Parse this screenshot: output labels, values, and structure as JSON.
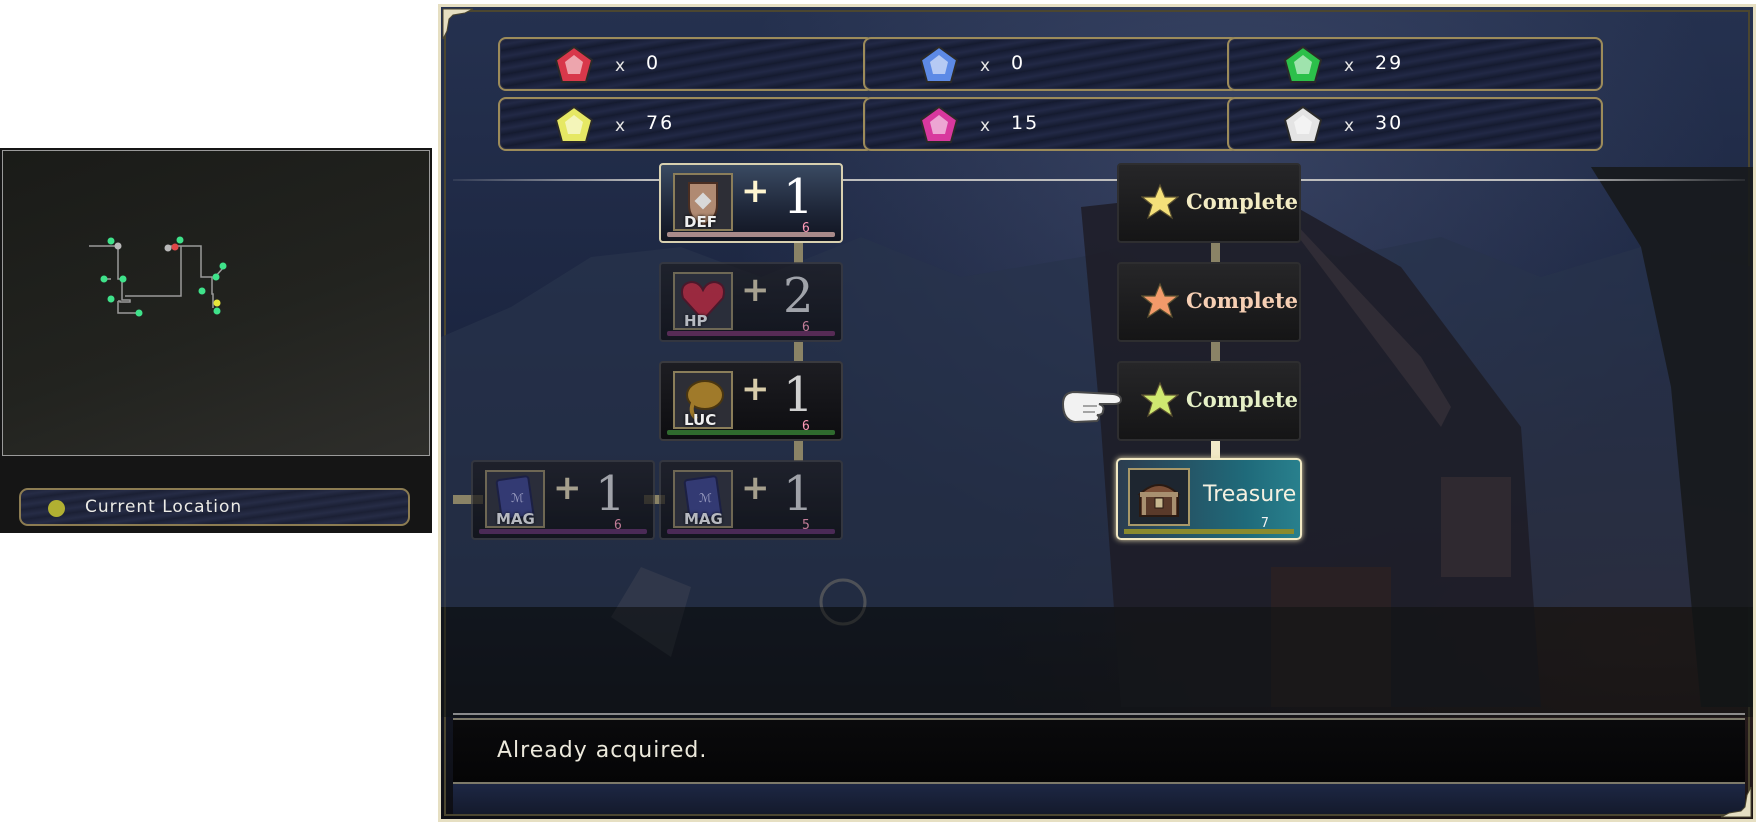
{
  "minimap": {
    "legend": {
      "label": "Current Location",
      "marker_color": "#b1b032"
    },
    "colors": {
      "visited_node": "#3fe28a",
      "unvisited_node": "#b9b9b9",
      "enemy_node": "#e04848",
      "current_node": "#e6e63a",
      "path_line": "#9a9a9a"
    }
  },
  "crystals": [
    {
      "name": "red",
      "x_label": "x",
      "count": "0",
      "color": "#d8384a"
    },
    {
      "name": "blue",
      "x_label": "x",
      "count": "0",
      "color": "#5d8ae6"
    },
    {
      "name": "green",
      "x_label": "x",
      "count": "29",
      "color": "#2cc04a"
    },
    {
      "name": "yellow",
      "x_label": "x",
      "count": "76",
      "color": "#e6e864"
    },
    {
      "name": "pink",
      "x_label": "x",
      "count": "15",
      "color": "#d8389e"
    },
    {
      "name": "white",
      "x_label": "x",
      "count": "30",
      "color": "#e4e4e4"
    }
  ],
  "skill_tree": {
    "stat_nodes": [
      {
        "id": "def",
        "stat": "DEF",
        "plus": "+",
        "value": "1",
        "cost": "6",
        "bar_color": "#a88a8a",
        "icon": "shield-icon"
      },
      {
        "id": "hp",
        "stat": "HP",
        "plus": "+",
        "value": "2",
        "cost": "6",
        "bar_color": "#6a2a5a",
        "icon": "heart-icon"
      },
      {
        "id": "luc",
        "stat": "LUC",
        "plus": "+",
        "value": "1",
        "cost": "6",
        "bar_color": "#2f6a2e",
        "icon": "clover-icon"
      },
      {
        "id": "mag-left",
        "stat": "MAG",
        "plus": "+",
        "value": "1",
        "cost": "6",
        "bar_color": "#5a2a5e",
        "icon": "spellbook-icon"
      },
      {
        "id": "mag-right",
        "stat": "MAG",
        "plus": "+",
        "value": "1",
        "cost": "5",
        "bar_color": "#5a2a5e",
        "icon": "spellbook-icon"
      }
    ],
    "complete_nodes": [
      {
        "label": "Complete",
        "star_color": "#f4e07a",
        "text_color": "#f3ecc4"
      },
      {
        "label": "Complete",
        "star_color": "#f29a6a",
        "text_color": "#f6cfb4"
      },
      {
        "label": "Complete",
        "star_color": "#cfe870",
        "text_color": "#e6f0c6"
      }
    ],
    "treasure": {
      "label": "Treasure",
      "cost": "7",
      "icon": "treasure-chest-icon"
    }
  },
  "message": "Already acquired."
}
